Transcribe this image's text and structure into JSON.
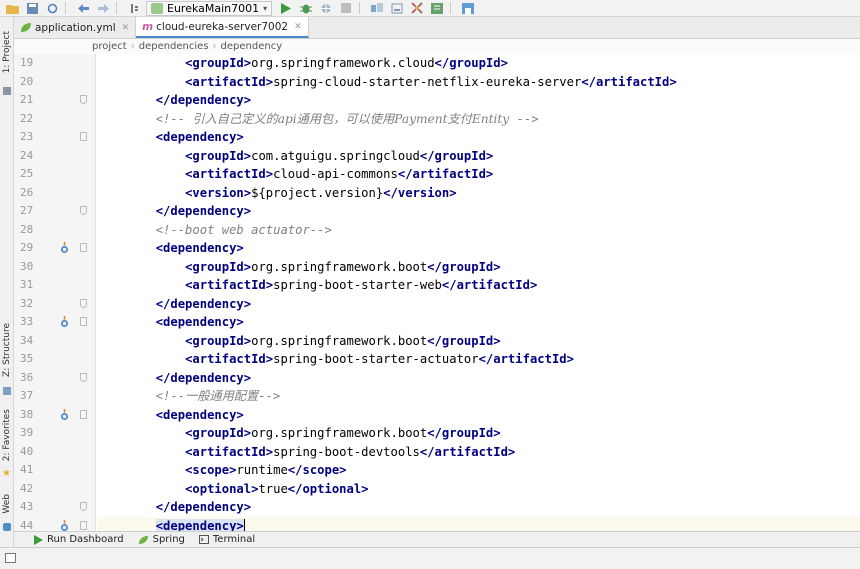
{
  "toolbar": {
    "run_config": "EurekaMain7001"
  },
  "left_strip": {
    "tabs": [
      "1: Project",
      "Z: Structure",
      "2: Favorites",
      "Web"
    ]
  },
  "tabs": [
    {
      "label": "application.yml",
      "active": false
    },
    {
      "label": "cloud-eureka-server7002",
      "active": true
    }
  ],
  "breadcrumb": [
    "project",
    "dependencies",
    "dependency"
  ],
  "editor": {
    "lines": [
      {
        "n": "19",
        "parts": [
          {
            "t": "            "
          },
          {
            "c": "tag",
            "t": "<groupId>"
          },
          {
            "t": "org.springframework.cloud"
          },
          {
            "c": "tag",
            "t": "</groupId>"
          }
        ]
      },
      {
        "n": "20",
        "parts": [
          {
            "t": "            "
          },
          {
            "c": "tag",
            "t": "<artifactId>"
          },
          {
            "t": "spring-cloud-starter-netflix-eureka-server"
          },
          {
            "c": "tag",
            "t": "</artifactId>"
          }
        ]
      },
      {
        "n": "21",
        "fold": "end",
        "parts": [
          {
            "t": "        "
          },
          {
            "c": "tag",
            "t": "</dependency>"
          }
        ]
      },
      {
        "n": "22",
        "parts": [
          {
            "t": "        "
          },
          {
            "c": "cmt",
            "t": "<!-- "
          },
          {
            "c": "cmt-cjk",
            "t": "引入自己定义的api通用包，可以使用Payment支付Entity"
          },
          {
            "c": "cmt",
            "t": " -->"
          }
        ]
      },
      {
        "n": "23",
        "fold": "start",
        "parts": [
          {
            "t": "        "
          },
          {
            "c": "tag",
            "t": "<dependency>"
          }
        ]
      },
      {
        "n": "24",
        "parts": [
          {
            "t": "            "
          },
          {
            "c": "tag",
            "t": "<groupId>"
          },
          {
            "t": "com.atguigu.springcloud"
          },
          {
            "c": "tag",
            "t": "</groupId>"
          }
        ]
      },
      {
        "n": "25",
        "parts": [
          {
            "t": "            "
          },
          {
            "c": "tag",
            "t": "<artifactId>"
          },
          {
            "t": "cloud-api-commons"
          },
          {
            "c": "tag",
            "t": "</artifactId>"
          }
        ]
      },
      {
        "n": "26",
        "parts": [
          {
            "t": "            "
          },
          {
            "c": "tag",
            "t": "<version>"
          },
          {
            "t": "${project.version}"
          },
          {
            "c": "tag",
            "t": "</version>"
          }
        ]
      },
      {
        "n": "27",
        "fold": "end",
        "parts": [
          {
            "t": "        "
          },
          {
            "c": "tag",
            "t": "</dependency>"
          }
        ]
      },
      {
        "n": "28",
        "parts": [
          {
            "t": "        "
          },
          {
            "c": "cmt",
            "t": "<!--boot web actuator-->"
          }
        ]
      },
      {
        "n": "29",
        "icon": true,
        "fold": "start",
        "parts": [
          {
            "t": "        "
          },
          {
            "c": "tag",
            "t": "<dependency>"
          }
        ]
      },
      {
        "n": "30",
        "parts": [
          {
            "t": "            "
          },
          {
            "c": "tag",
            "t": "<groupId>"
          },
          {
            "t": "org.springframework.boot"
          },
          {
            "c": "tag",
            "t": "</groupId>"
          }
        ]
      },
      {
        "n": "31",
        "parts": [
          {
            "t": "            "
          },
          {
            "c": "tag",
            "t": "<artifactId>"
          },
          {
            "t": "spring-boot-starter-web"
          },
          {
            "c": "tag",
            "t": "</artifactId>"
          }
        ]
      },
      {
        "n": "32",
        "fold": "end",
        "parts": [
          {
            "t": "        "
          },
          {
            "c": "tag",
            "t": "</dependency>"
          }
        ]
      },
      {
        "n": "33",
        "icon": true,
        "fold": "start",
        "parts": [
          {
            "t": "        "
          },
          {
            "c": "tag",
            "t": "<dependency>"
          }
        ]
      },
      {
        "n": "34",
        "parts": [
          {
            "t": "            "
          },
          {
            "c": "tag",
            "t": "<groupId>"
          },
          {
            "t": "org.springframework.boot"
          },
          {
            "c": "tag",
            "t": "</groupId>"
          }
        ]
      },
      {
        "n": "35",
        "parts": [
          {
            "t": "            "
          },
          {
            "c": "tag",
            "t": "<artifactId>"
          },
          {
            "t": "spring-boot-starter-actuator"
          },
          {
            "c": "tag",
            "t": "</artifactId>"
          }
        ]
      },
      {
        "n": "36",
        "fold": "end",
        "parts": [
          {
            "t": "        "
          },
          {
            "c": "tag",
            "t": "</dependency>"
          }
        ]
      },
      {
        "n": "37",
        "parts": [
          {
            "t": "        "
          },
          {
            "c": "cmt",
            "t": "<!--"
          },
          {
            "c": "cmt-cjk",
            "t": "一般通用配置"
          },
          {
            "c": "cmt",
            "t": "-->"
          }
        ]
      },
      {
        "n": "38",
        "icon": true,
        "fold": "start",
        "parts": [
          {
            "t": "        "
          },
          {
            "c": "tag",
            "t": "<dependency>"
          }
        ]
      },
      {
        "n": "39",
        "parts": [
          {
            "t": "            "
          },
          {
            "c": "tag",
            "t": "<groupId>"
          },
          {
            "t": "org.springframework.boot"
          },
          {
            "c": "tag",
            "t": "</groupId>"
          }
        ]
      },
      {
        "n": "40",
        "parts": [
          {
            "t": "            "
          },
          {
            "c": "tag",
            "t": "<artifactId>"
          },
          {
            "t": "spring-boot-devtools"
          },
          {
            "c": "tag",
            "t": "</artifactId>"
          }
        ]
      },
      {
        "n": "41",
        "parts": [
          {
            "t": "            "
          },
          {
            "c": "tag",
            "t": "<scope>"
          },
          {
            "t": "runtime"
          },
          {
            "c": "tag",
            "t": "</scope>"
          }
        ]
      },
      {
        "n": "42",
        "parts": [
          {
            "t": "            "
          },
          {
            "c": "tag",
            "t": "<optional>"
          },
          {
            "t": "true"
          },
          {
            "c": "tag",
            "t": "</optional>"
          }
        ]
      },
      {
        "n": "43",
        "fold": "end",
        "parts": [
          {
            "t": "        "
          },
          {
            "c": "tag",
            "t": "</dependency>"
          }
        ]
      },
      {
        "n": "44",
        "icon": true,
        "fold": "start",
        "current": true,
        "parts": [
          {
            "t": "        "
          },
          {
            "c": "tag hl",
            "t": "<dependency>"
          }
        ]
      }
    ]
  },
  "bottom_tabs": [
    {
      "label": "Run Dashboard",
      "icon": "play-icon",
      "color": "#3b9a3b"
    },
    {
      "label": "Spring",
      "icon": "spring-leaf-icon",
      "color": "#6db33f"
    },
    {
      "label": "Terminal",
      "icon": "terminal-icon",
      "color": "#555555"
    }
  ]
}
